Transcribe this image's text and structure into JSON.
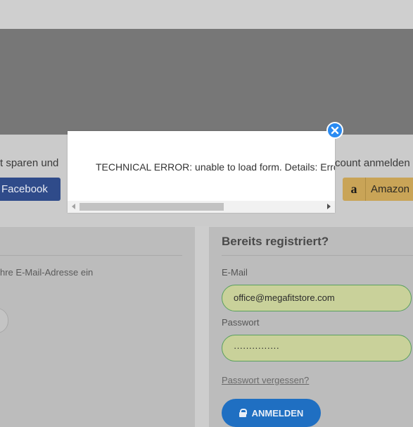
{
  "promo": {
    "left_text": "t sparen und",
    "right_text": "count anmelden"
  },
  "social": {
    "facebook_label": "Facebook",
    "amazon_label": "Amazon",
    "amazon_glyph": "a"
  },
  "left_panel": {
    "hint": "hre E-Mail-Adresse ein"
  },
  "login": {
    "heading": "Bereits registriert?",
    "email_label": "E-Mail",
    "email_value": "office@megafitstore.com",
    "password_label": "Passwort",
    "password_value": "···············",
    "forgot_link": "Passwort vergessen?",
    "submit_label": "ANMELDEN",
    "accent_color": "#1f6fc2",
    "field_color": "#c9d19a"
  },
  "modal": {
    "message": "TECHNICAL ERROR: unable to load form. Details: Error",
    "close_icon": "close-icon"
  }
}
